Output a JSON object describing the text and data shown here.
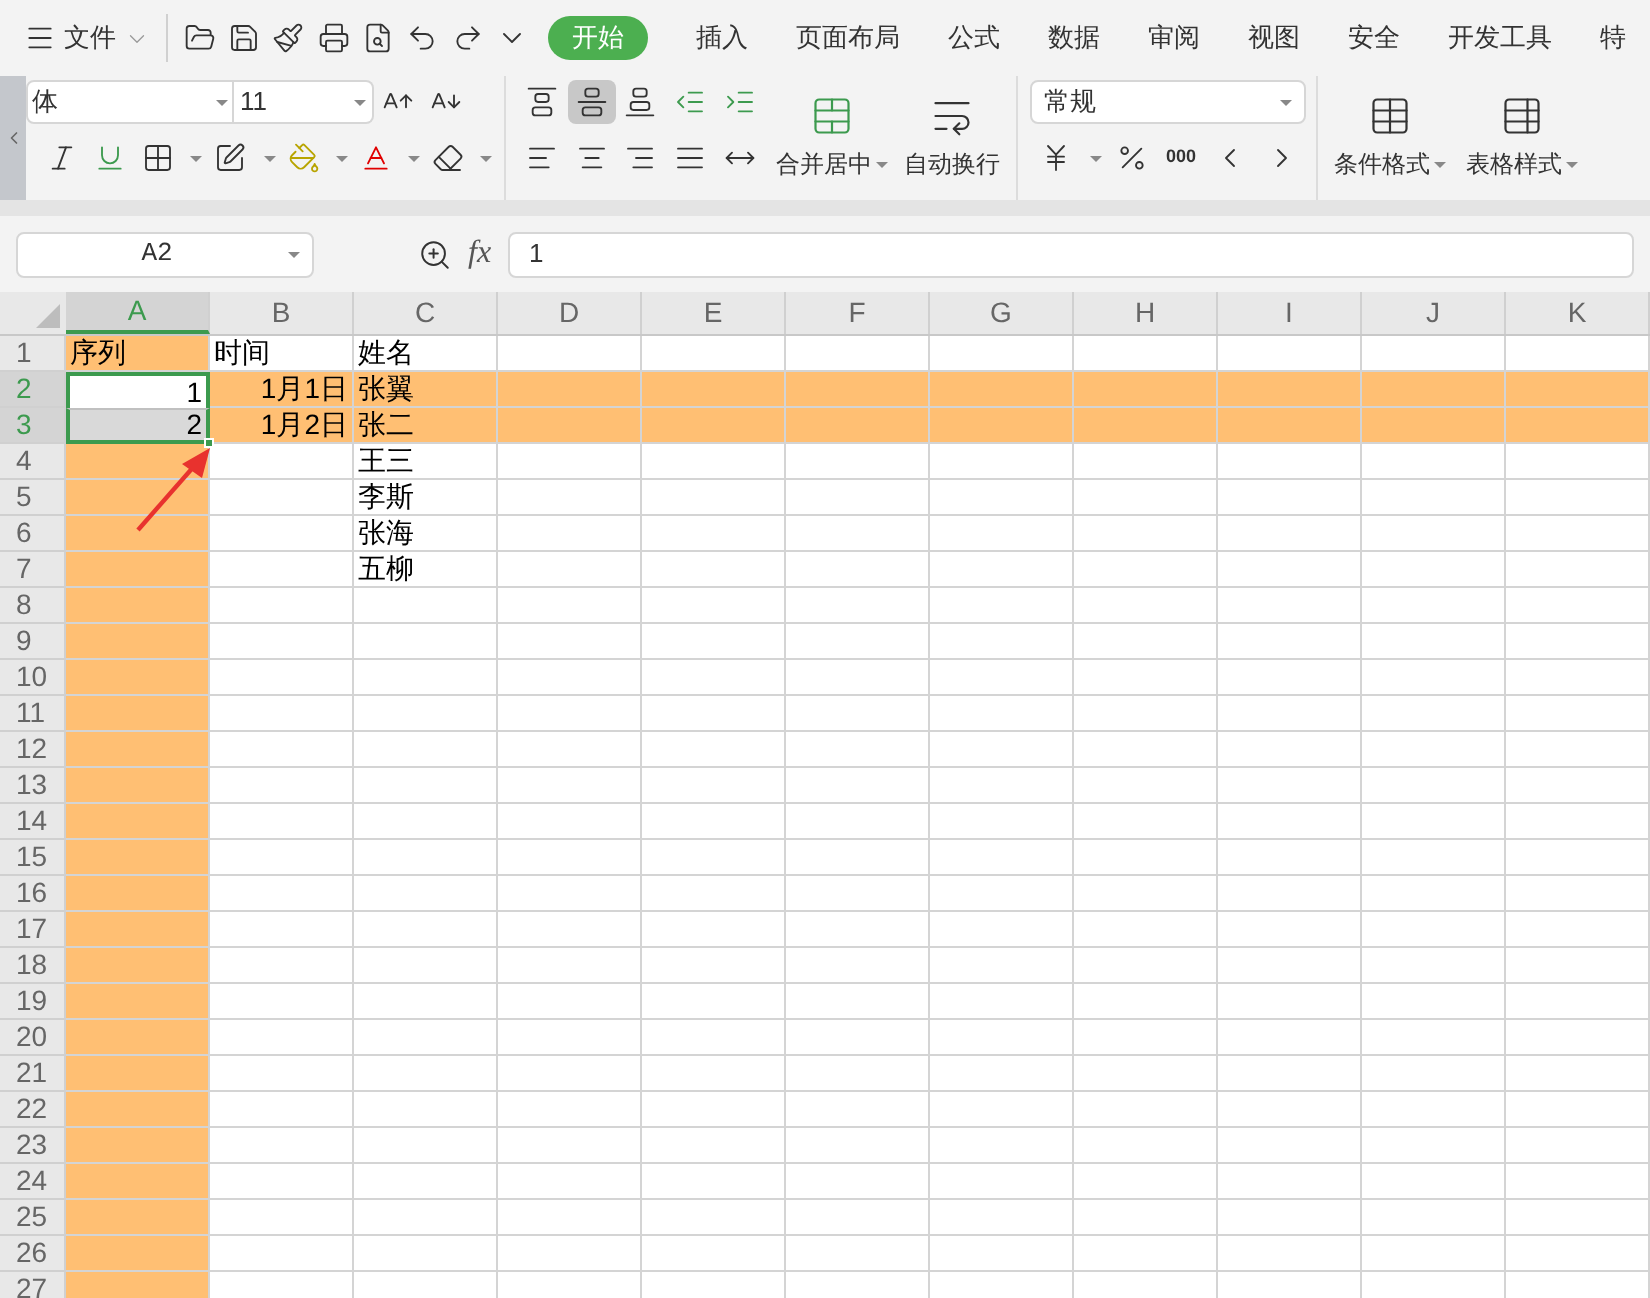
{
  "menu": {
    "file_label": "文件",
    "tabs": [
      {
        "label": "开始",
        "selected": true
      },
      {
        "label": "插入",
        "selected": false
      },
      {
        "label": "页面布局",
        "selected": false
      },
      {
        "label": "公式",
        "selected": false
      },
      {
        "label": "数据",
        "selected": false
      },
      {
        "label": "审阅",
        "selected": false
      },
      {
        "label": "视图",
        "selected": false
      },
      {
        "label": "安全",
        "selected": false
      },
      {
        "label": "开发工具",
        "selected": false
      },
      {
        "label": "特",
        "selected": false
      }
    ]
  },
  "ribbon": {
    "font_name": "体",
    "font_size": "11",
    "merge_label": "合并居中",
    "wrap_label": "自动换行",
    "number_format": "常规",
    "thousands": "000",
    "conditional_label": "条件格式",
    "table_style_label": "表格样式"
  },
  "formula_bar": {
    "name_box": "A2",
    "fx_label": "fx",
    "value": "1"
  },
  "sheet": {
    "columns": [
      {
        "letter": "A",
        "highlighted": true,
        "selected": true
      },
      {
        "letter": "B",
        "highlighted": false,
        "selected": false
      },
      {
        "letter": "C",
        "highlighted": false,
        "selected": false
      },
      {
        "letter": "D",
        "highlighted": false,
        "selected": false
      },
      {
        "letter": "E",
        "highlighted": false,
        "selected": false
      },
      {
        "letter": "F",
        "highlighted": false,
        "selected": false
      },
      {
        "letter": "G",
        "highlighted": false,
        "selected": false
      },
      {
        "letter": "H",
        "highlighted": false,
        "selected": false
      },
      {
        "letter": "I",
        "highlighted": false,
        "selected": false
      },
      {
        "letter": "J",
        "highlighted": false,
        "selected": false
      },
      {
        "letter": "K",
        "highlighted": false,
        "selected": false
      }
    ],
    "rows": [
      {
        "number": "1",
        "highlighted": false,
        "selected": false,
        "cells": [
          {
            "text": "序列",
            "kind": "text"
          },
          {
            "text": "时间",
            "kind": "text"
          },
          {
            "text": "姓名",
            "kind": "text"
          }
        ]
      },
      {
        "number": "2",
        "highlighted": true,
        "selected": true,
        "cells": [
          {
            "text": "1",
            "kind": "number"
          },
          {
            "text": "1月1日",
            "kind": "number"
          },
          {
            "text": "张翼",
            "kind": "text"
          }
        ]
      },
      {
        "number": "3",
        "highlighted": true,
        "selected": true,
        "cells": [
          {
            "text": "2",
            "kind": "number"
          },
          {
            "text": "1月2日",
            "kind": "number"
          },
          {
            "text": "张二",
            "kind": "text"
          }
        ]
      },
      {
        "number": "4",
        "highlighted": false,
        "selected": false,
        "cells": [
          {
            "kind": "empty"
          },
          {
            "kind": "empty"
          },
          {
            "text": "王三",
            "kind": "text"
          }
        ]
      },
      {
        "number": "5",
        "highlighted": false,
        "selected": false,
        "cells": [
          {
            "kind": "empty"
          },
          {
            "kind": "empty"
          },
          {
            "text": "李斯",
            "kind": "text"
          }
        ]
      },
      {
        "number": "6",
        "highlighted": false,
        "selected": false,
        "cells": [
          {
            "kind": "empty"
          },
          {
            "kind": "empty"
          },
          {
            "text": "张海",
            "kind": "text"
          }
        ]
      },
      {
        "number": "7",
        "highlighted": false,
        "selected": false,
        "cells": [
          {
            "kind": "empty"
          },
          {
            "kind": "empty"
          },
          {
            "text": "五柳",
            "kind": "text"
          }
        ]
      },
      {
        "number": "8",
        "highlighted": false,
        "selected": false
      },
      {
        "number": "9",
        "highlighted": false,
        "selected": false
      },
      {
        "number": "10",
        "highlighted": false,
        "selected": false
      },
      {
        "number": "11",
        "highlighted": false,
        "selected": false
      },
      {
        "number": "12",
        "highlighted": false,
        "selected": false
      },
      {
        "number": "13",
        "highlighted": false,
        "selected": false
      },
      {
        "number": "14",
        "highlighted": false,
        "selected": false
      },
      {
        "number": "15",
        "highlighted": false,
        "selected": false
      },
      {
        "number": "16",
        "highlighted": false,
        "selected": false
      },
      {
        "number": "17",
        "highlighted": false,
        "selected": false
      },
      {
        "number": "18",
        "highlighted": false,
        "selected": false
      },
      {
        "number": "19",
        "highlighted": false,
        "selected": false
      },
      {
        "number": "20",
        "highlighted": false,
        "selected": false
      },
      {
        "number": "21",
        "highlighted": false,
        "selected": false
      },
      {
        "number": "22",
        "highlighted": false,
        "selected": false
      },
      {
        "number": "23",
        "highlighted": false,
        "selected": false
      },
      {
        "number": "24",
        "highlighted": false,
        "selected": false
      },
      {
        "number": "25",
        "highlighted": false,
        "selected": false
      },
      {
        "number": "26",
        "highlighted": false,
        "selected": false
      },
      {
        "number": "27",
        "highlighted": false,
        "selected": false
      }
    ]
  }
}
